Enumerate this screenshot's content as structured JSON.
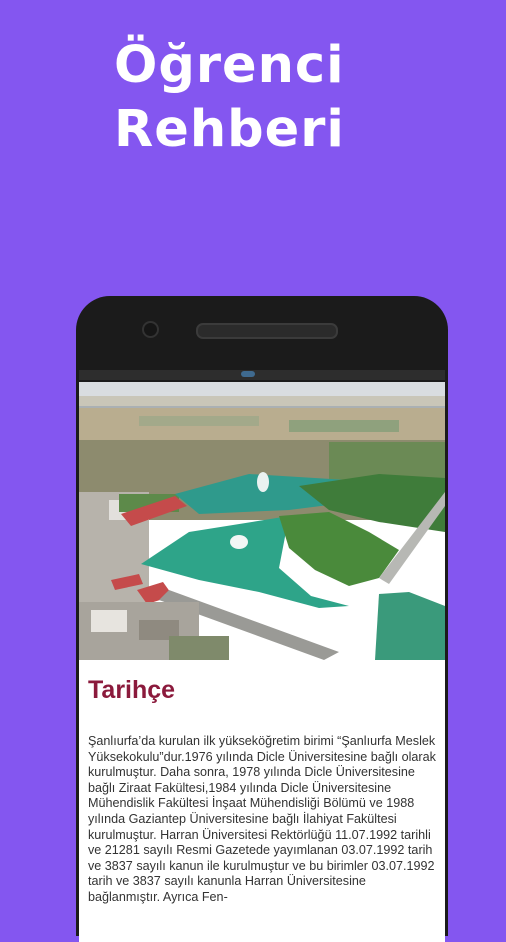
{
  "header": {
    "line1": "Öğrenci",
    "line2": "Rehberi"
  },
  "screen": {
    "image": {
      "name": "campus-aerial-image"
    },
    "title": "Tarihçe",
    "body": " Şanlıurfa’da kurulan ilk yükseköğretim birimi “Şanlıurfa Meslek Yüksekokulu”dur.1976 yılında Dicle Üniversitesine bağlı olarak kurulmuştur. Daha sonra, 1978 yılında Dicle Üniversitesine bağlı Ziraat Fakültesi,1984 yılında Dicle Üniversitesine Mühendislik Fakültesi İnşaat Mühendisliği Bölümü ve 1988 yılında Gaziantep Üniversitesine bağlı İlahiyat Fakültesi kurulmuştur. Harran Üniversitesi Rektörlüğü 11.07.1992 tarihli ve 21281 sayılı Resmi Gazetede yayımlanan 03.07.1992 tarih ve 3837 sayılı kanun ile kurulmuştur ve bu birimler 03.07.1992 tarih ve 3837 sayılı kanunla Harran Üniversitesine bağlanmıştır. Ayrıca Fen-"
  },
  "colors": {
    "background": "#8456f0",
    "title": "#8b1a3c"
  }
}
